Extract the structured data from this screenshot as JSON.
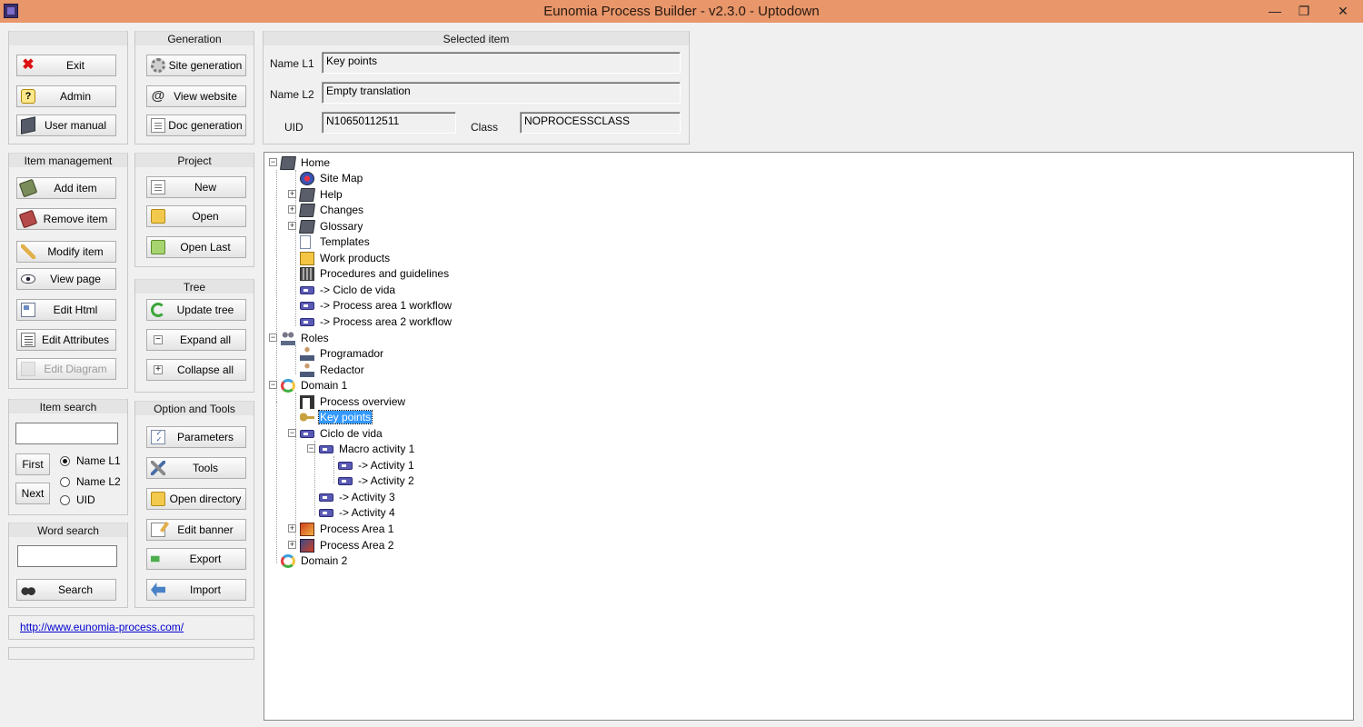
{
  "window": {
    "title": "Eunomia Process Builder - v2.3.0  - Uptodown",
    "minimize": "—",
    "maximize": "❐",
    "close": "✕"
  },
  "panels": {
    "generation": "Generation",
    "selected_item": "Selected item",
    "item_management": "Item management",
    "project": "Project",
    "tree": "Tree",
    "item_search": "Item search",
    "option_tools": "Option and Tools",
    "word_search": "Word search"
  },
  "buttons": {
    "exit": "Exit",
    "admin": "Admin",
    "user_manual": "User manual",
    "site_generation": "Site generation",
    "view_website": "View website",
    "doc_generation": "Doc generation",
    "add_item": "Add item",
    "remove_item": "Remove item",
    "modify_item": "Modify item",
    "view_page": "View page",
    "edit_html": "Edit Html",
    "edit_attributes": "Edit Attributes",
    "edit_diagram": "Edit Diagram",
    "new": "New",
    "open": "Open",
    "open_last": "Open Last",
    "update_tree": "Update tree",
    "expand_all": "Expand all",
    "collapse_all": "Collapse all",
    "parameters": "Parameters",
    "tools": "Tools",
    "open_directory": "Open directory",
    "edit_banner": "Edit banner",
    "export": "Export",
    "import": "Import",
    "first": "First",
    "next": "Next",
    "search": "Search"
  },
  "selected": {
    "name_l1_label": "Name L1",
    "name_l1_value": "Key points",
    "name_l2_label": "Name L2",
    "name_l2_value": "Empty translation",
    "uid_label": "UID",
    "uid_value": "N10650112511",
    "class_label": "Class",
    "class_value": "NOPROCESSCLASS"
  },
  "item_search": {
    "value": "",
    "options": [
      "Name L1",
      "Name L2",
      "UID"
    ],
    "selected": "Name L1"
  },
  "word_search": {
    "value": ""
  },
  "link": "http://www.eunomia-process.com/",
  "tree": {
    "expander_collapsed": "+",
    "expander_expanded": "−",
    "nodes": [
      {
        "label": "Home",
        "icon": "book-icon"
      },
      {
        "label": "Site Map",
        "icon": "sitemap-icon"
      },
      {
        "label": "Help",
        "icon": "book-icon"
      },
      {
        "label": "Changes",
        "icon": "book-icon"
      },
      {
        "label": "Glossary",
        "icon": "book-icon"
      },
      {
        "label": "Templates",
        "icon": "document-icon"
      },
      {
        "label": "Work products",
        "icon": "work-product-icon"
      },
      {
        "label": "Procedures and guidelines",
        "icon": "procedures-icon"
      },
      {
        "label": "-> Ciclo de vida",
        "icon": "link-arrow-icon"
      },
      {
        "label": "-> Process area 1 workflow",
        "icon": "link-arrow-icon"
      },
      {
        "label": "-> Process area 2 workflow",
        "icon": "link-arrow-icon"
      },
      {
        "label": "Roles",
        "icon": "roles-icon"
      },
      {
        "label": "Programador",
        "icon": "person-icon"
      },
      {
        "label": "Redactor",
        "icon": "person-icon"
      },
      {
        "label": "Domain 1",
        "icon": "domain-icon"
      },
      {
        "label": "Process overview",
        "icon": "overview-icon"
      },
      {
        "label": "Key points",
        "icon": "key-icon",
        "selected": true
      },
      {
        "label": "Ciclo de vida",
        "icon": "link-arrow-icon"
      },
      {
        "label": "Macro activity 1",
        "icon": "link-arrow-icon"
      },
      {
        "label": "-> Activity 1",
        "icon": "link-arrow-icon"
      },
      {
        "label": "-> Activity 2",
        "icon": "link-arrow-icon"
      },
      {
        "label": "-> Activity 3",
        "icon": "link-arrow-icon"
      },
      {
        "label": "-> Activity 4",
        "icon": "link-arrow-icon"
      },
      {
        "label": "Process Area 1",
        "icon": "process-area-icon"
      },
      {
        "label": "Process Area 2",
        "icon": "process-area-icon"
      },
      {
        "label": "Domain 2",
        "icon": "domain-icon"
      }
    ]
  },
  "colors": {
    "titlebar": "#e8966a",
    "selection": "#3399ff",
    "link": "#0000d0"
  }
}
